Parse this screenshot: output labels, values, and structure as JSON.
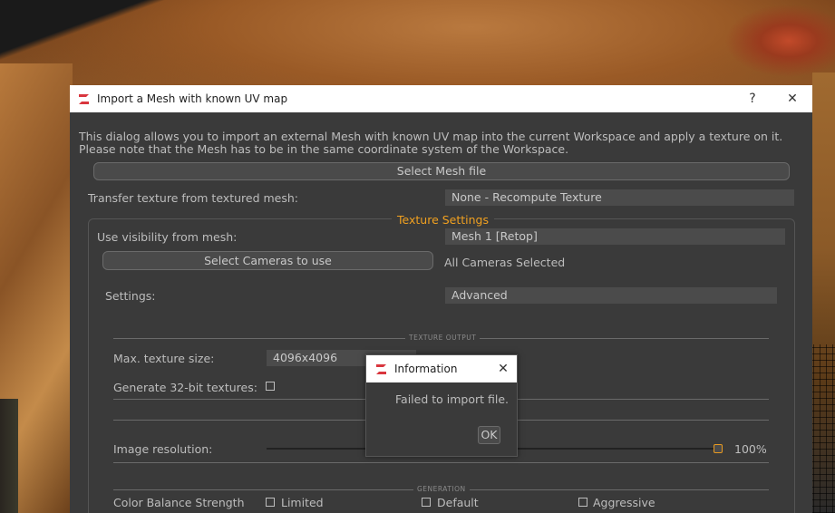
{
  "dialog": {
    "title": "Import a Mesh with known UV map",
    "help_label": "?",
    "close_label": "✕",
    "intro_line1": "This dialog allows you to import an external Mesh with known UV map into the current Workspace and apply a texture on it.",
    "intro_line2": "Please note that the Mesh has to be in the same coordinate system of the Workspace.",
    "select_mesh_button": "Select Mesh file",
    "transfer_label": "Transfer texture from textured mesh:",
    "transfer_value": "None - Recompute Texture",
    "texture_settings_title": "Texture Settings",
    "visibility_label": "Use visibility from mesh:",
    "visibility_value": "Mesh 1 [Retop]",
    "select_cameras_button": "Select Cameras to use",
    "cameras_status": "All Cameras Selected",
    "settings_label": "Settings:",
    "settings_value": "Advanced",
    "texture_output_title": "TEXTURE OUTPUT",
    "max_texture_label": "Max. texture size:",
    "max_texture_value": "4096x4096",
    "generate32_label": "Generate 32-bit textures:",
    "image_resolution_label": "Image resolution:",
    "image_resolution_value": "100%",
    "image_resolution_level": 1.0,
    "generation_title": "GENERATION",
    "color_balance_label": "Color Balance Strength",
    "color_balance_options": [
      "Limited",
      "Default",
      "Aggressive"
    ]
  },
  "info_popup": {
    "title": "Information",
    "close_label": "✕",
    "message": "Failed to import file.",
    "ok_label": "OK"
  },
  "colors": {
    "accent": "#f0a020",
    "dialog_bg": "#3a3a3a",
    "field_bg": "#4b4b4b"
  }
}
